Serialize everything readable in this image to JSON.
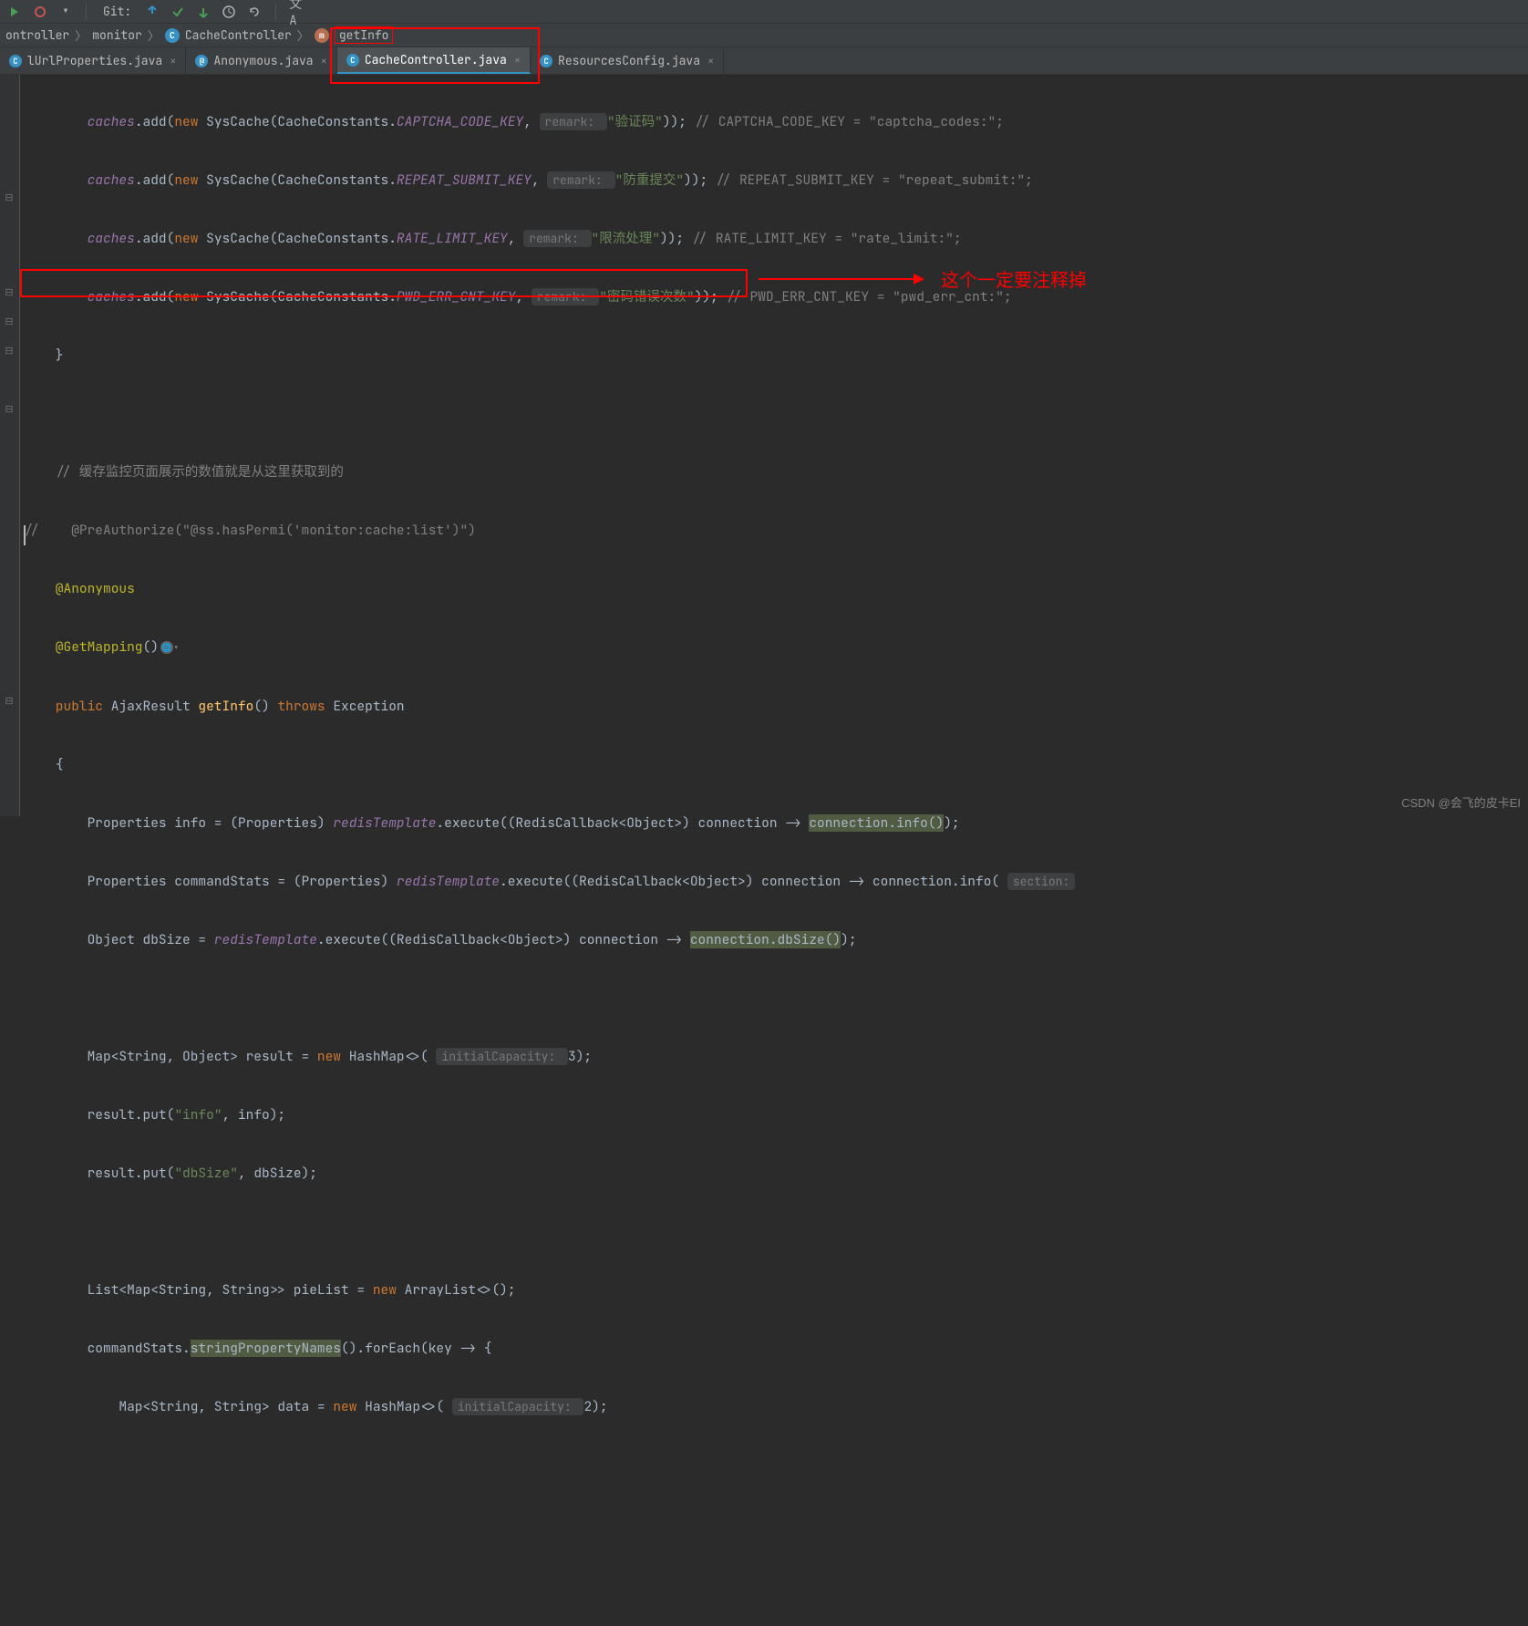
{
  "toolbar": {
    "git_label": "Git:"
  },
  "breadcrumb": {
    "items": [
      "ontroller",
      "monitor",
      "CacheController",
      "getInfo"
    ]
  },
  "tabs": [
    {
      "label": "lUrlProperties.java",
      "icon": "c",
      "active": false
    },
    {
      "label": "Anonymous.java",
      "icon": "at",
      "active": false
    },
    {
      "label": "CacheController.java",
      "icon": "c",
      "active": true
    },
    {
      "label": "ResourcesConfig.java",
      "icon": "c",
      "active": false
    }
  ],
  "annotation": {
    "text": "这个一定要注释掉"
  },
  "watermark": "CSDN @会飞的皮卡EI",
  "code": {
    "line1_pre": "        caches.add(new SysCache(CacheConstants.CAPTCHA_CODE_KEY, ",
    "line1_hint": "remark: ",
    "line1_str": "\"验证码\"",
    "line1_post": ")); // CAPTCHA_CODE_KEY = \"captcha_codes:\";",
    "line2_pre": "        caches",
    "line2_add": ".add(",
    "line2_new": "new",
    "line2_sc": " SysCache(CacheConstants.",
    "line2_key": "REPEAT_SUBMIT_KEY",
    "line2_c": ", ",
    "line2_hint": "remark: ",
    "line2_str": "\"防重提交\"",
    "line2_post": ")); ",
    "line2_cm": "// REPEAT_SUBMIT_KEY = \"repeat_submit:\";",
    "line3_key": "RATE_LIMIT_KEY",
    "line3_str": "\"限流处理\"",
    "line3_cm": "// RATE_LIMIT_KEY = \"rate_limit:\";",
    "line4_key": "PWD_ERR_CNT_KEY",
    "line4_str": "\"密码错误次数\"",
    "line4_cm": "// PWD_ERR_CNT_KEY = \"pwd_err_cnt:\";",
    "brace_close": "    }",
    "cm_cache": "    // 缓存监控页面展示的数值就是从这里获取到的",
    "cm_pre": "//    @PreAuthorize(\"@ss.hasPermi('monitor:cache:list')\")",
    "ann_anon": "    @Anonymous",
    "ann_get": "    @GetMapping",
    "ann_get_paren": "()",
    "pub": "    public",
    "ajax": " AjaxResult ",
    "getinfo": "getInfo",
    "getinfo_p": "() ",
    "throws": "throws",
    "exc": " Exception",
    "ob": "    {",
    "l_info_a": "        Properties info = (Properties) ",
    "l_info_b": "redisTemplate",
    "l_info_c": ".execute((RedisCallback<Object>) connection -> ",
    "l_info_d": "connection.info()",
    "l_info_e": ");",
    "l_cs_a": "        Properties commandStats = (Properties) ",
    "l_cs_b": "redisTemplate",
    "l_cs_c": ".execute((RedisCallback<Object>) connection -> connection.info( ",
    "l_cs_hint": "section:",
    "l_db_a": "        Object dbSize = ",
    "l_db_b": "redisTemplate",
    "l_db_c": ".execute((RedisCallback<Object>) connection -> ",
    "l_db_d": "connection.dbSize()",
    "l_db_e": ");",
    "l_map_a": "        Map<String, Object> result = ",
    "l_map_new": "new",
    "l_map_b": " HashMap<>( ",
    "l_map_hint": "initialCapacity: ",
    "l_map_c": "3",
    "l_map_d": ");",
    "l_put1_a": "        result.put(",
    "l_put1_s": "\"info\"",
    "l_put1_b": ", info);",
    "l_put2_a": "        result.put(",
    "l_put2_s": "\"dbSize\"",
    "l_put2_b": ", dbSize);",
    "l_pie_a": "        List<Map<String, String>> pieList = ",
    "l_pie_new": "new",
    "l_pie_b": " ArrayList<>();",
    "l_for_a": "        commandStats.",
    "l_for_b": "stringPropertyNames",
    "l_for_c": "().forEach(key -> {",
    "l_last_a": "            Map<String, String> data = ",
    "l_last_new": "new",
    "l_last_b": " HashMap<>( ",
    "l_last_hint": "initialCapacity: ",
    "l_last_c": "2",
    "l_last_d": ");"
  }
}
